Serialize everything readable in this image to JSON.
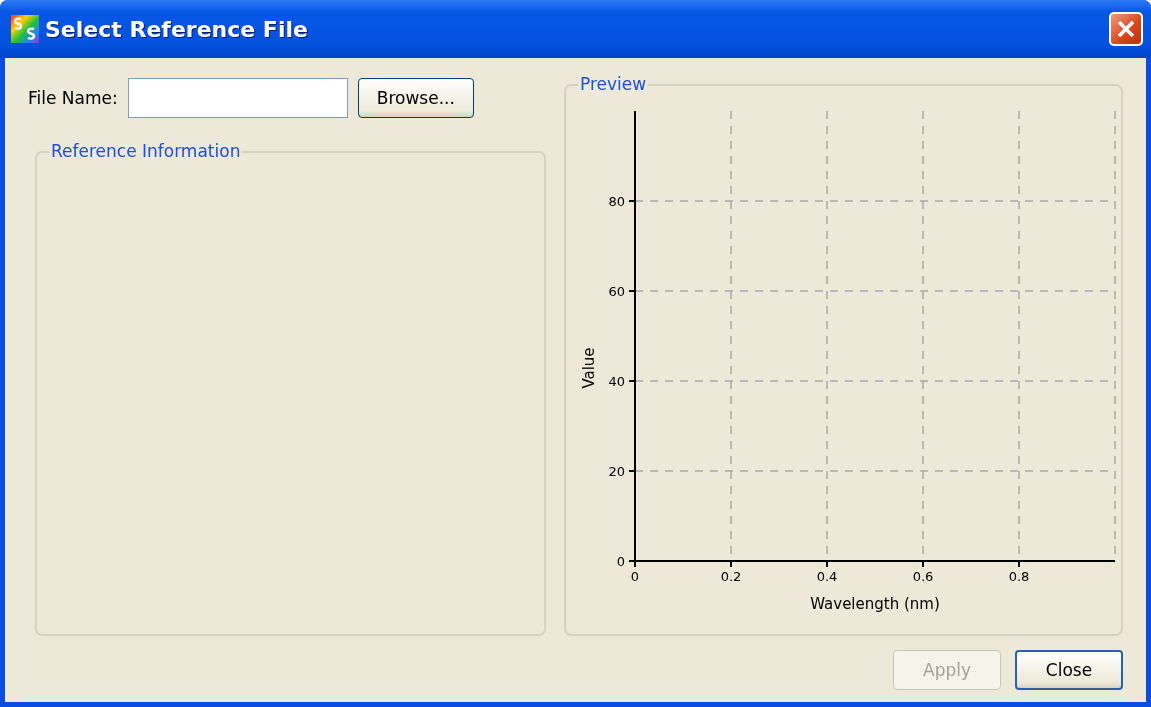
{
  "window": {
    "title": "Select Reference File"
  },
  "file_name": {
    "label": "File Name:",
    "browse_button": "Browse..."
  },
  "reference_information": {
    "title": "Reference Information"
  },
  "preview": {
    "title": "Preview",
    "chart_data": {
      "type": "line",
      "xlabel": "Wavelength (nm)",
      "ylabel": "Value",
      "xlim": [
        0,
        1
      ],
      "ylim": [
        0,
        100
      ],
      "xticks": [
        0,
        0.2,
        0.4,
        0.6,
        0.8
      ],
      "yticks": [
        0,
        20,
        40,
        60,
        80
      ],
      "grid": true
    }
  },
  "buttons": [
    {
      "label": "Apply",
      "disabled": true,
      "default": false
    },
    {
      "label": "Close",
      "disabled": false,
      "default": true
    }
  ]
}
